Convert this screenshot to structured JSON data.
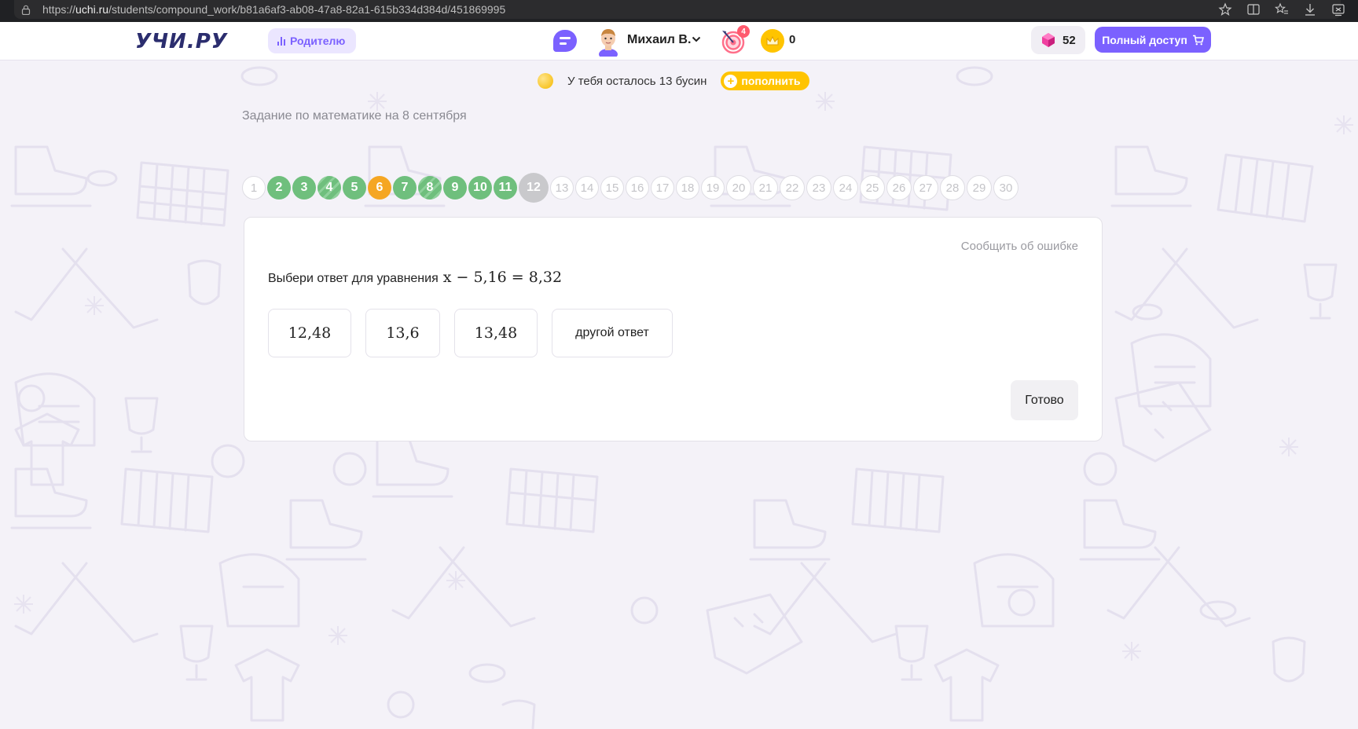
{
  "browser": {
    "url_prefix": "https://",
    "url_host": "uchi.ru",
    "url_path": "/students/compound_work/b81a6af3-ab08-47a8-82a1-615b334d384d/451869995"
  },
  "header": {
    "logo": "УЧИ.РУ",
    "parent_label": "Родителю",
    "user_name": "Михаил В.",
    "target_badge": "4",
    "crowns": "0",
    "gems": "52",
    "full_access_label": "Полный доступ"
  },
  "beads": {
    "text": "У тебя осталось 13 бусин",
    "refill_label": "пополнить"
  },
  "task": {
    "title": "Задание по математике на 8 сентября",
    "report_label": "Сообщить об ошибке",
    "question_text": "Выбери ответ для уравнения",
    "equation": "x − 5,16 = 8,32",
    "answers": [
      "12,48",
      "13,6",
      "13,48",
      "другой ответ"
    ],
    "done_label": "Готово"
  },
  "progress": {
    "items": [
      {
        "n": "1",
        "state": "empty"
      },
      {
        "n": "2",
        "state": "green"
      },
      {
        "n": "3",
        "state": "green"
      },
      {
        "n": "4",
        "state": "striped"
      },
      {
        "n": "5",
        "state": "green"
      },
      {
        "n": "6",
        "state": "orange"
      },
      {
        "n": "7",
        "state": "green"
      },
      {
        "n": "8",
        "state": "striped"
      },
      {
        "n": "9",
        "state": "green"
      },
      {
        "n": "10",
        "state": "green"
      },
      {
        "n": "11",
        "state": "green"
      },
      {
        "n": "12",
        "state": "current"
      },
      {
        "n": "13",
        "state": "empty"
      },
      {
        "n": "14",
        "state": "empty"
      },
      {
        "n": "15",
        "state": "empty"
      },
      {
        "n": "16",
        "state": "empty"
      },
      {
        "n": "17",
        "state": "empty"
      },
      {
        "n": "18",
        "state": "empty"
      },
      {
        "n": "19",
        "state": "empty"
      },
      {
        "n": "20",
        "state": "empty"
      },
      {
        "n": "21",
        "state": "empty"
      },
      {
        "n": "22",
        "state": "empty"
      },
      {
        "n": "23",
        "state": "empty"
      },
      {
        "n": "24",
        "state": "empty"
      },
      {
        "n": "25",
        "state": "empty"
      },
      {
        "n": "26",
        "state": "empty"
      },
      {
        "n": "27",
        "state": "empty"
      },
      {
        "n": "28",
        "state": "empty"
      },
      {
        "n": "29",
        "state": "empty"
      },
      {
        "n": "30",
        "state": "empty"
      }
    ]
  },
  "colors": {
    "accent": "#7b61ff",
    "done": "#6fbf7d",
    "error": "#f5a623",
    "current": "#c9c9cc",
    "coin": "#ffc400"
  }
}
